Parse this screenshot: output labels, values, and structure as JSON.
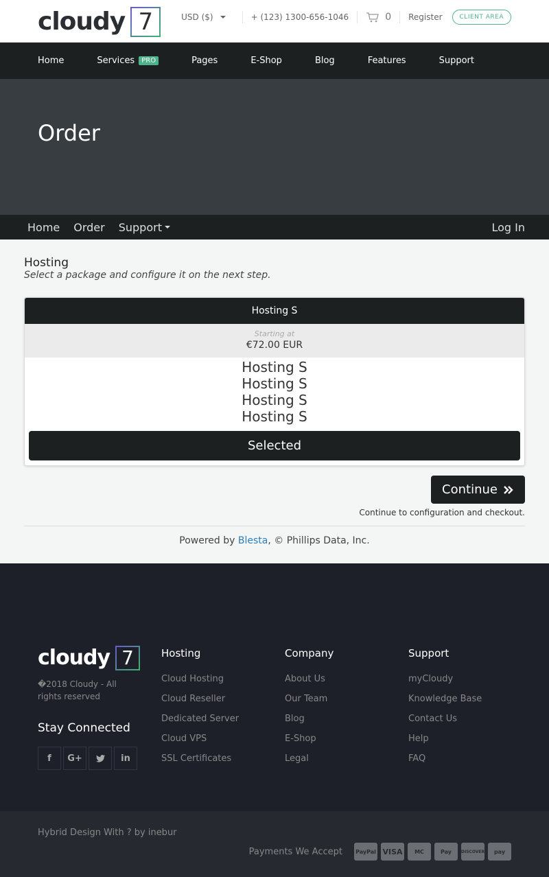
{
  "brand": {
    "word": "cloudy",
    "number": "7"
  },
  "topbar": {
    "currency": "USD ($)",
    "phone": "+ (123) 1300-656-1046",
    "cart_count": "0",
    "register": "Register",
    "client_area": "CLIENT AREA"
  },
  "mainnav": [
    {
      "label": "Home"
    },
    {
      "label": "Services",
      "badge": "PRO"
    },
    {
      "label": "Pages"
    },
    {
      "label": "E-Shop"
    },
    {
      "label": "Blog"
    },
    {
      "label": "Features"
    },
    {
      "label": "Support"
    }
  ],
  "hero": {
    "title": "Order"
  },
  "subnav": {
    "home": "Home",
    "order": "Order",
    "support": "Support",
    "login": "Log In"
  },
  "content": {
    "heading": "Hosting",
    "subheading": "Select a package and configure it on the next step.",
    "package": {
      "name": "Hosting S",
      "starting": "Starting at",
      "price": "€72.00 EUR",
      "features": [
        "Hosting S",
        "Hosting S",
        "Hosting S",
        "Hosting S"
      ],
      "selected_label": "Selected"
    },
    "continue_label": "Continue",
    "continue_note": "Continue to configuration and checkout."
  },
  "powered": {
    "prefix": "Powered by ",
    "link": "Blesta",
    "suffix": ", © Phillips Data, Inc."
  },
  "footer": {
    "copyright": "�2018 Cloudy - All rights reserved",
    "stay_connected": "Stay Connected",
    "columns": [
      {
        "title": "Hosting",
        "items": [
          "Cloud Hosting",
          "Cloud Reseller",
          "Dedicated Server",
          "Cloud VPS",
          "SSL Certificates"
        ]
      },
      {
        "title": "Company",
        "items": [
          "About Us",
          "Our Team",
          "Blog",
          "E-Shop",
          "Legal"
        ]
      },
      {
        "title": "Support",
        "items": [
          "myCloudy",
          "Knowledge Base",
          "Contact Us",
          "Help",
          "FAQ"
        ]
      }
    ],
    "credit": "Hybrid Design With ? by inebur",
    "payments_label": "Payments We Accept",
    "cards": [
      "PayPal",
      "VISA",
      "MC",
      "Pay",
      "DISCOVER",
      "pay"
    ]
  },
  "colors": {
    "accent": "#4db38a",
    "dark": "#1d2021",
    "hero": "#383d42",
    "footer": "#1e2029",
    "link": "#2980b9"
  }
}
